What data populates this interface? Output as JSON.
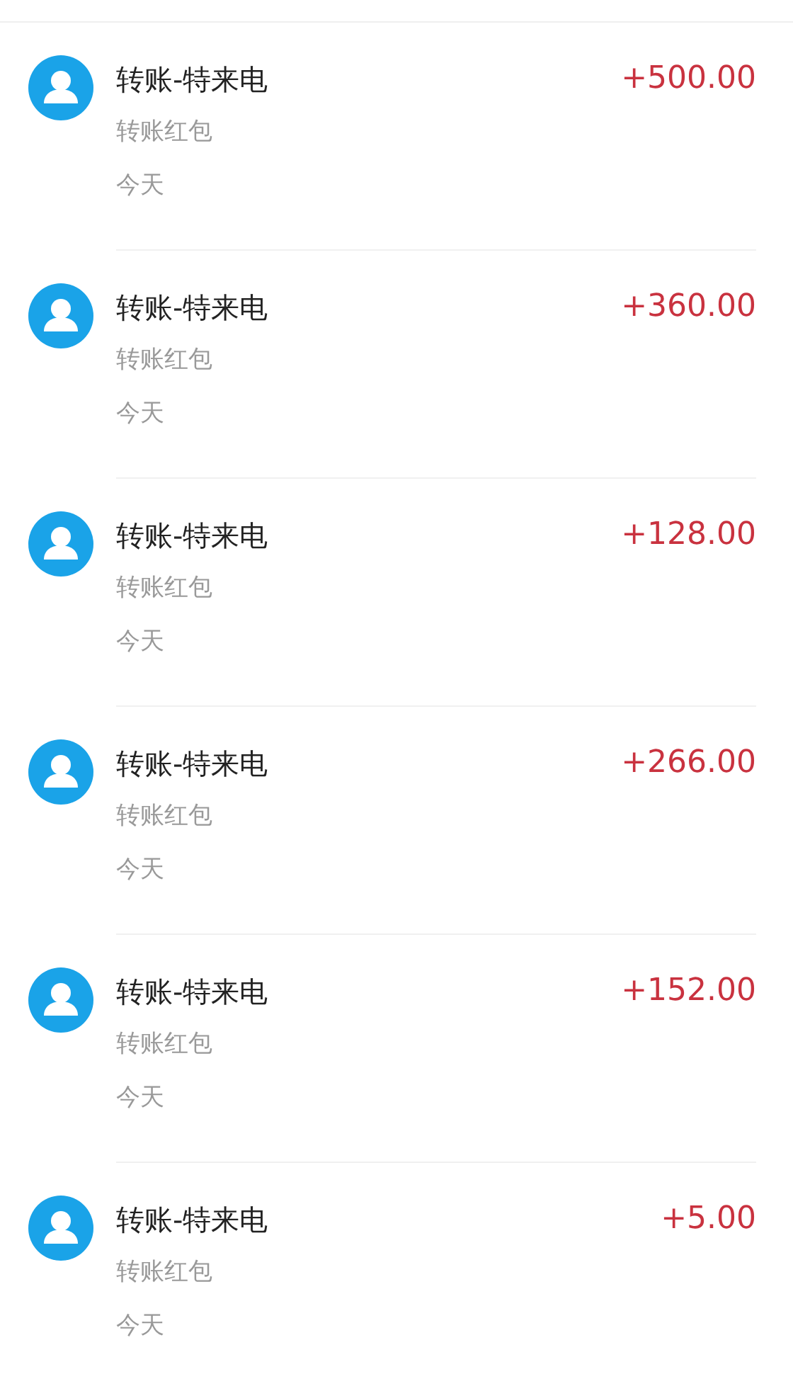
{
  "transactions": [
    {
      "title": "转账-特来电",
      "subtitle": "转账红包",
      "date": "今天",
      "amount": "+500.00"
    },
    {
      "title": "转账-特来电",
      "subtitle": "转账红包",
      "date": "今天",
      "amount": "+360.00"
    },
    {
      "title": "转账-特来电",
      "subtitle": "转账红包",
      "date": "今天",
      "amount": "+128.00"
    },
    {
      "title": "转账-特来电",
      "subtitle": "转账红包",
      "date": "今天",
      "amount": "+266.00"
    },
    {
      "title": "转账-特来电",
      "subtitle": "转账红包",
      "date": "今天",
      "amount": "+152.00"
    },
    {
      "title": "转账-特来电",
      "subtitle": "转账红包",
      "date": "今天",
      "amount": "+5.00"
    }
  ]
}
